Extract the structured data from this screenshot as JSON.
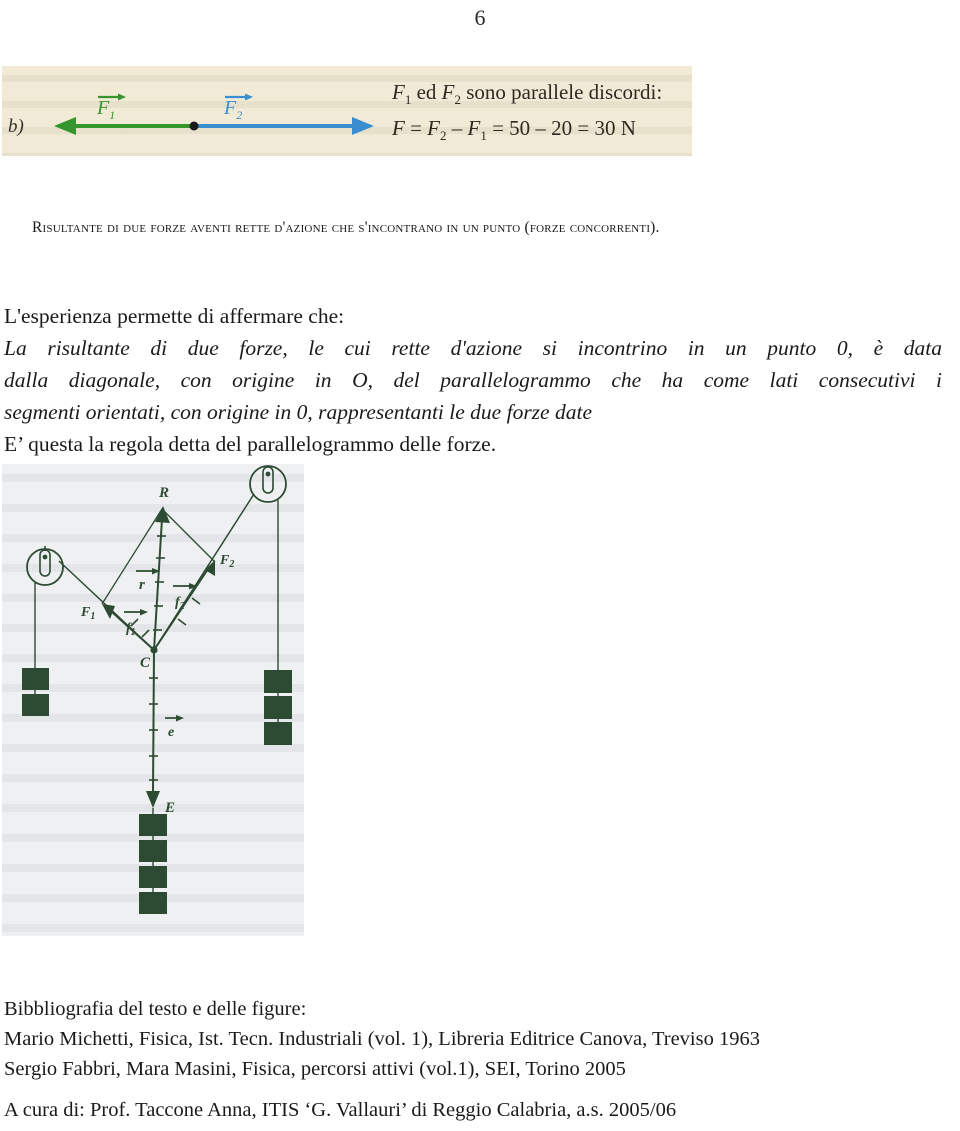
{
  "page": {
    "number": "6"
  },
  "figure_b": {
    "panel_label": "b)",
    "vector_f1_label": "F",
    "vector_f1_sub": "1",
    "vector_f2_label": "F",
    "vector_f2_sub": "2",
    "color_f1": "#36962e",
    "color_f2": "#3a8ecf",
    "background": "#f1ead6",
    "caption_line1_pre": "F",
    "caption_line1_sub1": "1",
    "caption_line1_mid": " ed ",
    "caption_line1_f2": "F",
    "caption_line1_sub2": "2",
    "caption_line1_post": " sono parallele discordi:",
    "caption_line2": "F = F2 – F1 = 50 – 20 = 30 N",
    "caption_line2_parts": {
      "f": "F",
      "eq1": " = ",
      "f2": "F",
      "sub2": "2",
      "minus": " – ",
      "f1": "F",
      "sub1": "1",
      "eq2": " = 50 – 20 = 30 N"
    }
  },
  "heading": {
    "text": "Risultante di due forze aventi rette d'azione che s'incontrano in un punto (forze concorrenti)."
  },
  "body": {
    "intro": "L'esperienza permette di affermare che:",
    "statement_line1": "La risultante di due forze, le cui rette d'azione si incontrino in un punto 0, è data",
    "statement_line2": "dalla diagonale, con origine in O, del parallelogrammo che  ha come lati consecutivi i",
    "statement_line3": "segmenti orientati, con origine in 0, rappresentanti le due forze date",
    "closing": "E’ questa la regola detta del parallelogrammo delle forze."
  },
  "figure_parallelogram": {
    "background": "#eff0f2",
    "ink_color": "#2d4a32",
    "labels": {
      "resultant": "R",
      "force1": "F",
      "force1_sub": "1",
      "force2": "F",
      "force2_sub": "2",
      "r_vector": "r",
      "f1_vector": "f",
      "f1_vector_sub": "1",
      "f2_vector": "f",
      "f2_vector_sub": "2",
      "center": "C",
      "e_vector": "e",
      "equilibrant": "E"
    }
  },
  "bibliography": {
    "heading": "Bibbliografia del testo e delle figure:",
    "entries": [
      "Mario Michetti, Fisica, Ist. Tecn. Industriali (vol. 1), Libreria Editrice Canova, Treviso 1963",
      "Sergio Fabbri, Mara Masini, Fisica, percorsi attivi (vol.1), SEI, Torino 2005"
    ],
    "credit": "A cura di: Prof. Taccone Anna, ITIS ‘G. Vallauri’ di Reggio Calabria, a.s. 2005/06"
  }
}
